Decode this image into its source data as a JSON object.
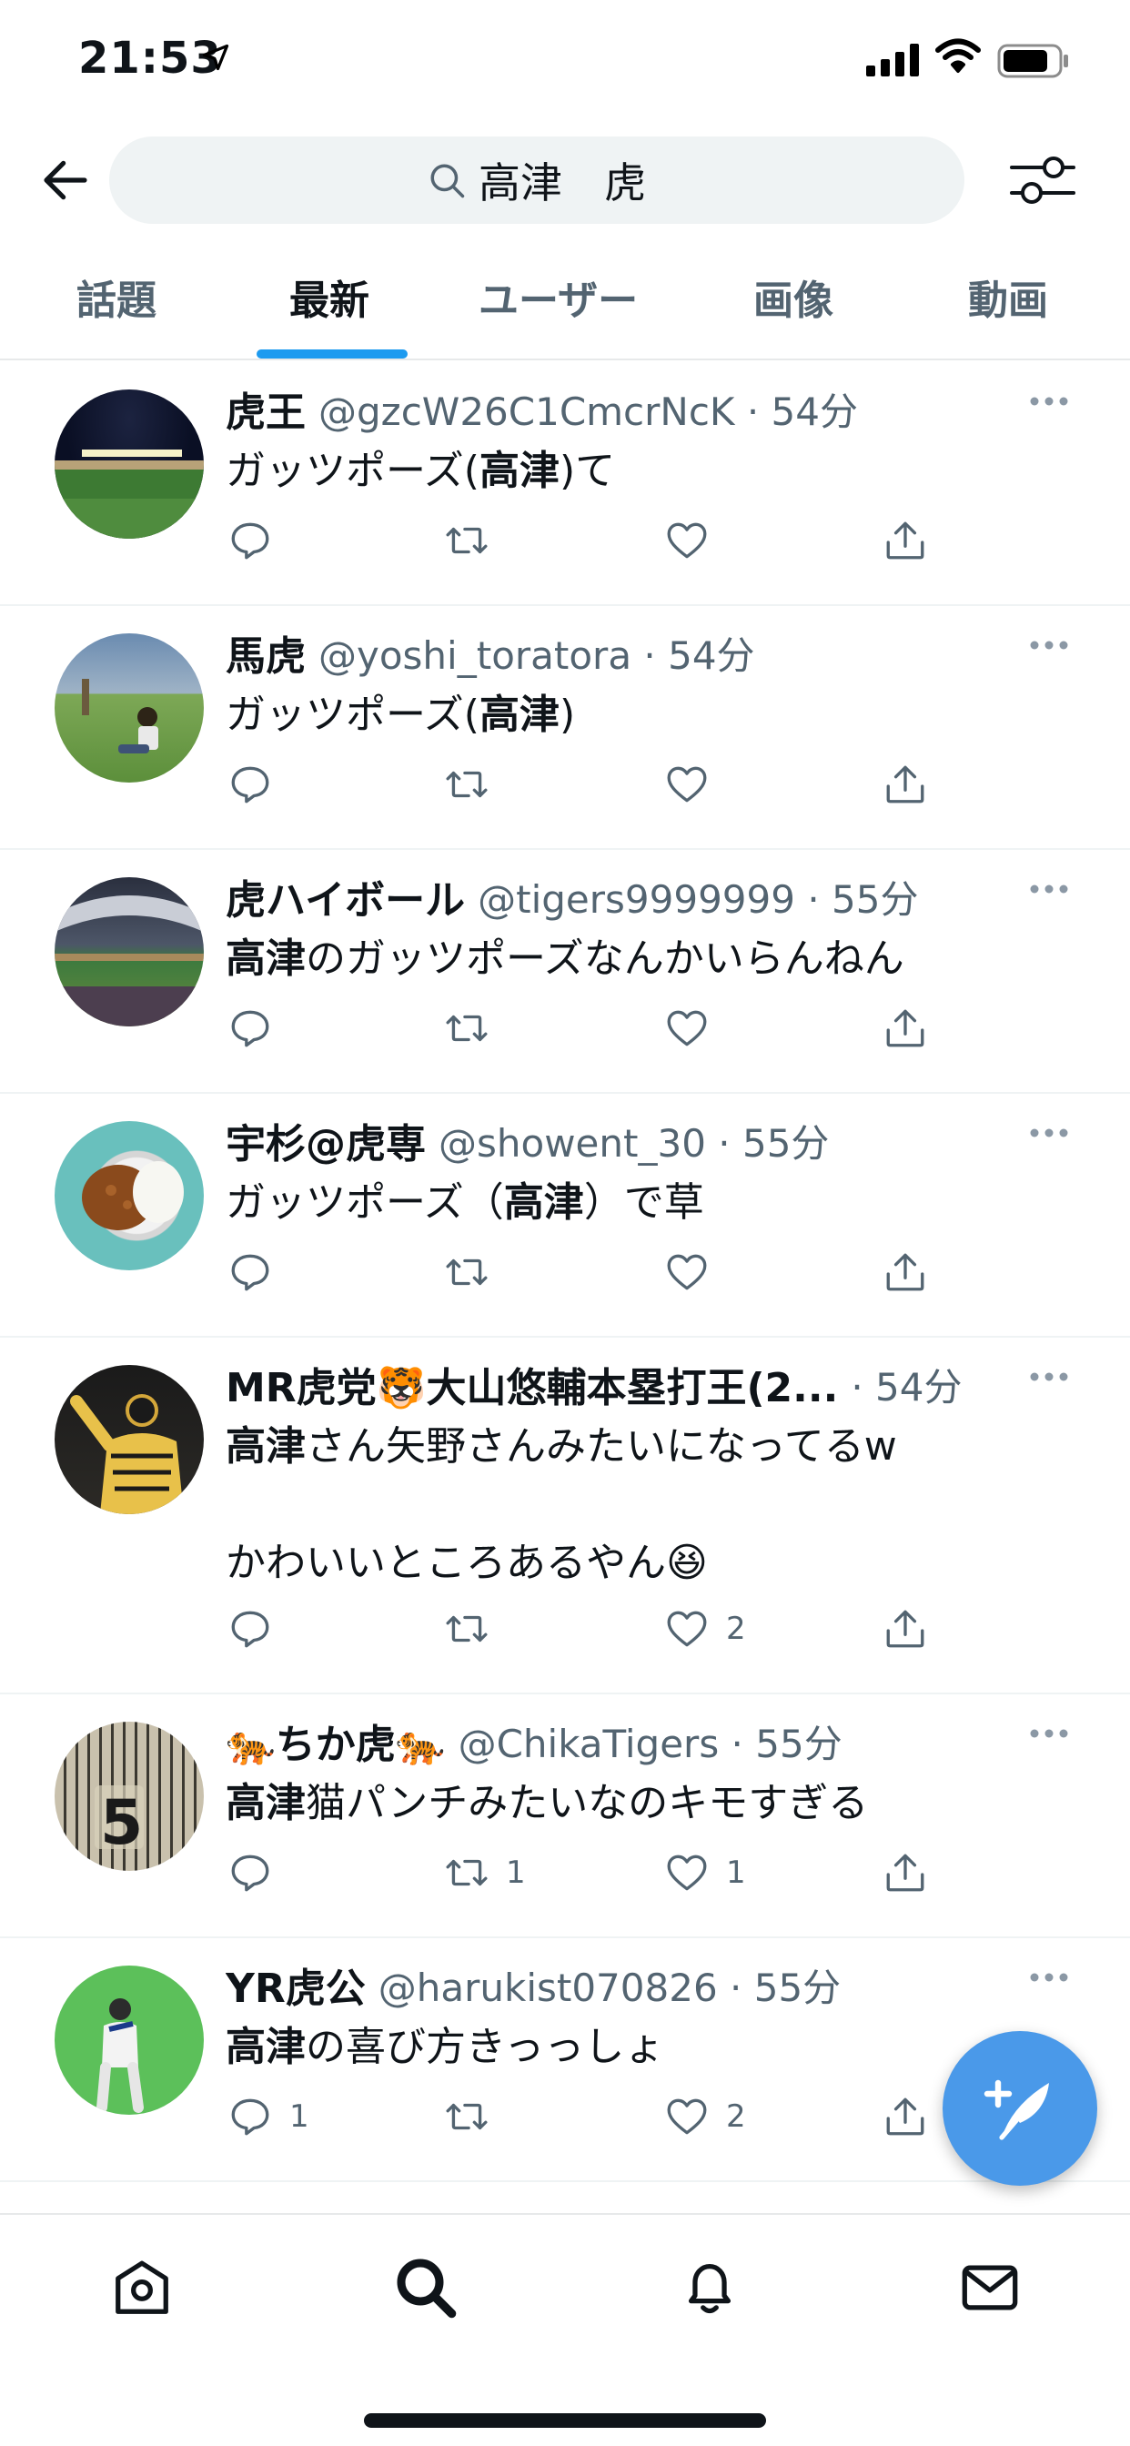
{
  "status_bar": {
    "time": "21:53"
  },
  "search": {
    "query": "高津　虎"
  },
  "tabs": [
    {
      "label": "話題"
    },
    {
      "label": "最新"
    },
    {
      "label": "ユーザー"
    },
    {
      "label": "画像"
    },
    {
      "label": "動画"
    }
  ],
  "active_tab": "最新",
  "tweets": [
    {
      "display_name": "虎王",
      "handle_time": "@gzcW26C1CmcrNcK · 54分",
      "text_parts": [
        "ガッツポーズ(",
        "高津",
        ")て"
      ],
      "replies": "",
      "retweets": "",
      "likes": ""
    },
    {
      "display_name": "馬虎",
      "handle_time": "@yoshi_toratora · 54分",
      "text_parts": [
        "ガッツポーズ(",
        "高津",
        ")"
      ],
      "replies": "",
      "retweets": "",
      "likes": ""
    },
    {
      "display_name": "虎ハイボール",
      "handle_time": "@tigers9999999 · 55分",
      "text_parts": [
        "",
        "高津",
        "のガッツポーズなんかいらんねん"
      ],
      "replies": "",
      "retweets": "",
      "likes": ""
    },
    {
      "display_name": "宇杉@虎専",
      "handle_time": "@showent_30 · 55分",
      "text_parts": [
        "ガッツポーズ（",
        "高津",
        "）で草"
      ],
      "replies": "",
      "retweets": "",
      "likes": ""
    },
    {
      "display_name": "MR虎党🐯大山悠輔本塁打王(2...",
      "handle_time": "· 54分",
      "text_parts": [
        "",
        "高津",
        "さん矢野さんみたいになってるw\n\nかわいいところあるやん😆"
      ],
      "replies": "",
      "retweets": "",
      "likes": "2"
    },
    {
      "display_name": "🐅ちか虎🐅",
      "handle_time": "@ChikaTigers · 55分",
      "text_parts": [
        "",
        "高津",
        "猫パンチみたいなのキモすぎる"
      ],
      "replies": "",
      "retweets": "1",
      "likes": "1"
    },
    {
      "display_name": "YR虎公",
      "handle_time": "@harukist070826 · 55分",
      "text_parts": [
        "",
        "高津",
        "の喜び方きっっしょ"
      ],
      "replies": "1",
      "retweets": "",
      "likes": "2"
    }
  ],
  "icons": {
    "back": "arrow-left-icon",
    "search": "search-icon",
    "filter": "sliders-icon",
    "more": "more-dots-icon",
    "compose": "feather-plus-icon",
    "nav": [
      "home-icon",
      "search-icon",
      "bell-icon",
      "mail-icon"
    ]
  },
  "colors": {
    "accent": "#1d9bf0",
    "fab": "#4a99e9",
    "text": "#0f1419",
    "secondary": "#536471"
  }
}
